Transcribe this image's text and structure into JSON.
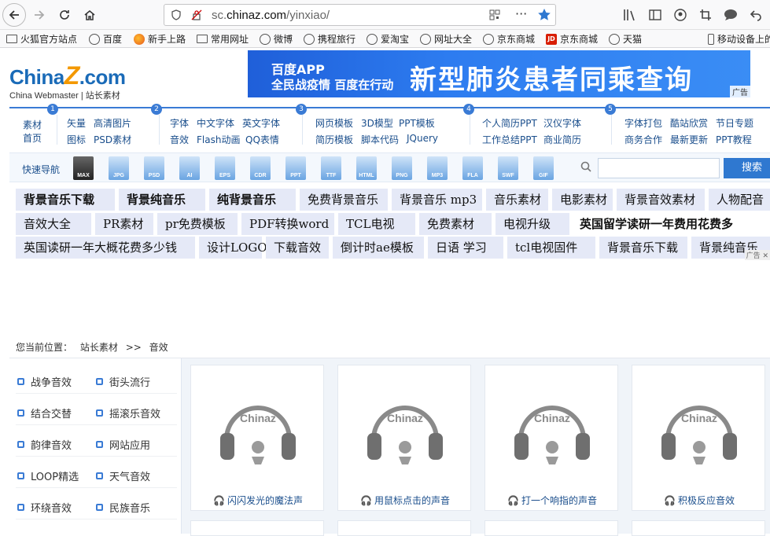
{
  "browser": {
    "url_prefix": "sc.",
    "url_domain": "chinaz.com",
    "url_path": "/yinxiao/",
    "bookmarks": [
      "火狐官方站点",
      "百度",
      "新手上路",
      "常用网址",
      "微博",
      "携程旅行",
      "爱淘宝",
      "网址大全",
      "京东商城",
      "京东商城",
      "天猫",
      "移动设备上的"
    ]
  },
  "site": {
    "logo_main_a": "China",
    "logo_main_z": "Z",
    "logo_main_b": ".com",
    "logo_sub": "China Webmaster | 站长素材",
    "banner": {
      "app": "百度APP",
      "slogan": "全民战疫情 百度在行动",
      "title": "新型肺炎患者同乘查询",
      "ad": "广告"
    }
  },
  "catnav": {
    "home_a": "素材",
    "home_b": "首页",
    "nums": [
      "1",
      "2",
      "3",
      "4",
      "5"
    ],
    "g1": [
      "矢量",
      "高清图片",
      "图标",
      "PSD素材"
    ],
    "g2": [
      "字体",
      "中文字体",
      "英文字体",
      "音效",
      "Flash动画",
      "QQ表情"
    ],
    "g3": [
      "网页模板",
      "3D模型",
      "PPT模板",
      "简历模板",
      "脚本代码",
      "JQuery"
    ],
    "g4": [
      "个人简历PPT",
      "汉仪字体",
      "工作总结PPT",
      "商业简历"
    ],
    "g5": [
      "字体打包",
      "酷站欣赏",
      "节日专题",
      "商务合作",
      "最新更新",
      "PPT教程"
    ]
  },
  "quicknav": {
    "label": "快速导航",
    "types": [
      "MAX",
      "JPG",
      "PSD",
      "AI",
      "EPS",
      "CDR",
      "PPT",
      "TTF",
      "HTML",
      "PNG",
      "MP3",
      "FLA",
      "SWF",
      "GIF"
    ],
    "search_button": "搜索"
  },
  "tags": {
    "row1": [
      "背景音乐下载",
      "背景纯音乐",
      "纯背景音乐",
      "免费背景音乐",
      "背景音乐 mp3",
      "音乐素材",
      "电影素材",
      "背景音效素材",
      "人物配音"
    ],
    "row2": [
      "音效大全",
      "PR素材",
      "pr免费模板",
      "PDF转换word",
      "TCL电视",
      "免费素材",
      "电视升级",
      "英国留学读研一年费用花费多"
    ],
    "row3": [
      "英国读研一年大概花费多少钱",
      "设计LOGO",
      "下载音效",
      "倒计时ae模板",
      "日语 学习",
      "tcl电视固件",
      "背景音乐下载",
      "背景纯音乐"
    ],
    "ad_mark": "广告"
  },
  "breadcrumb": {
    "label": "您当前位置：",
    "crumb1": "站长素材",
    "sep": ">>",
    "crumb2": "音效"
  },
  "sidebar": {
    "items": [
      "战争音效",
      "街头流行",
      "结合交替",
      "摇滚乐音效",
      "韵律音效",
      "网站应用",
      "LOOP精选",
      "天气音效",
      "环绕音效",
      "民族音乐"
    ]
  },
  "cards": [
    {
      "title": "闪闪发光的魔法声",
      "brand": "Chinaz"
    },
    {
      "title": "用鼠标点击的声音",
      "brand": "Chinaz"
    },
    {
      "title": "打一个响指的声音",
      "brand": "Chinaz"
    },
    {
      "title": "积极反应音效",
      "brand": "Chinaz"
    }
  ]
}
